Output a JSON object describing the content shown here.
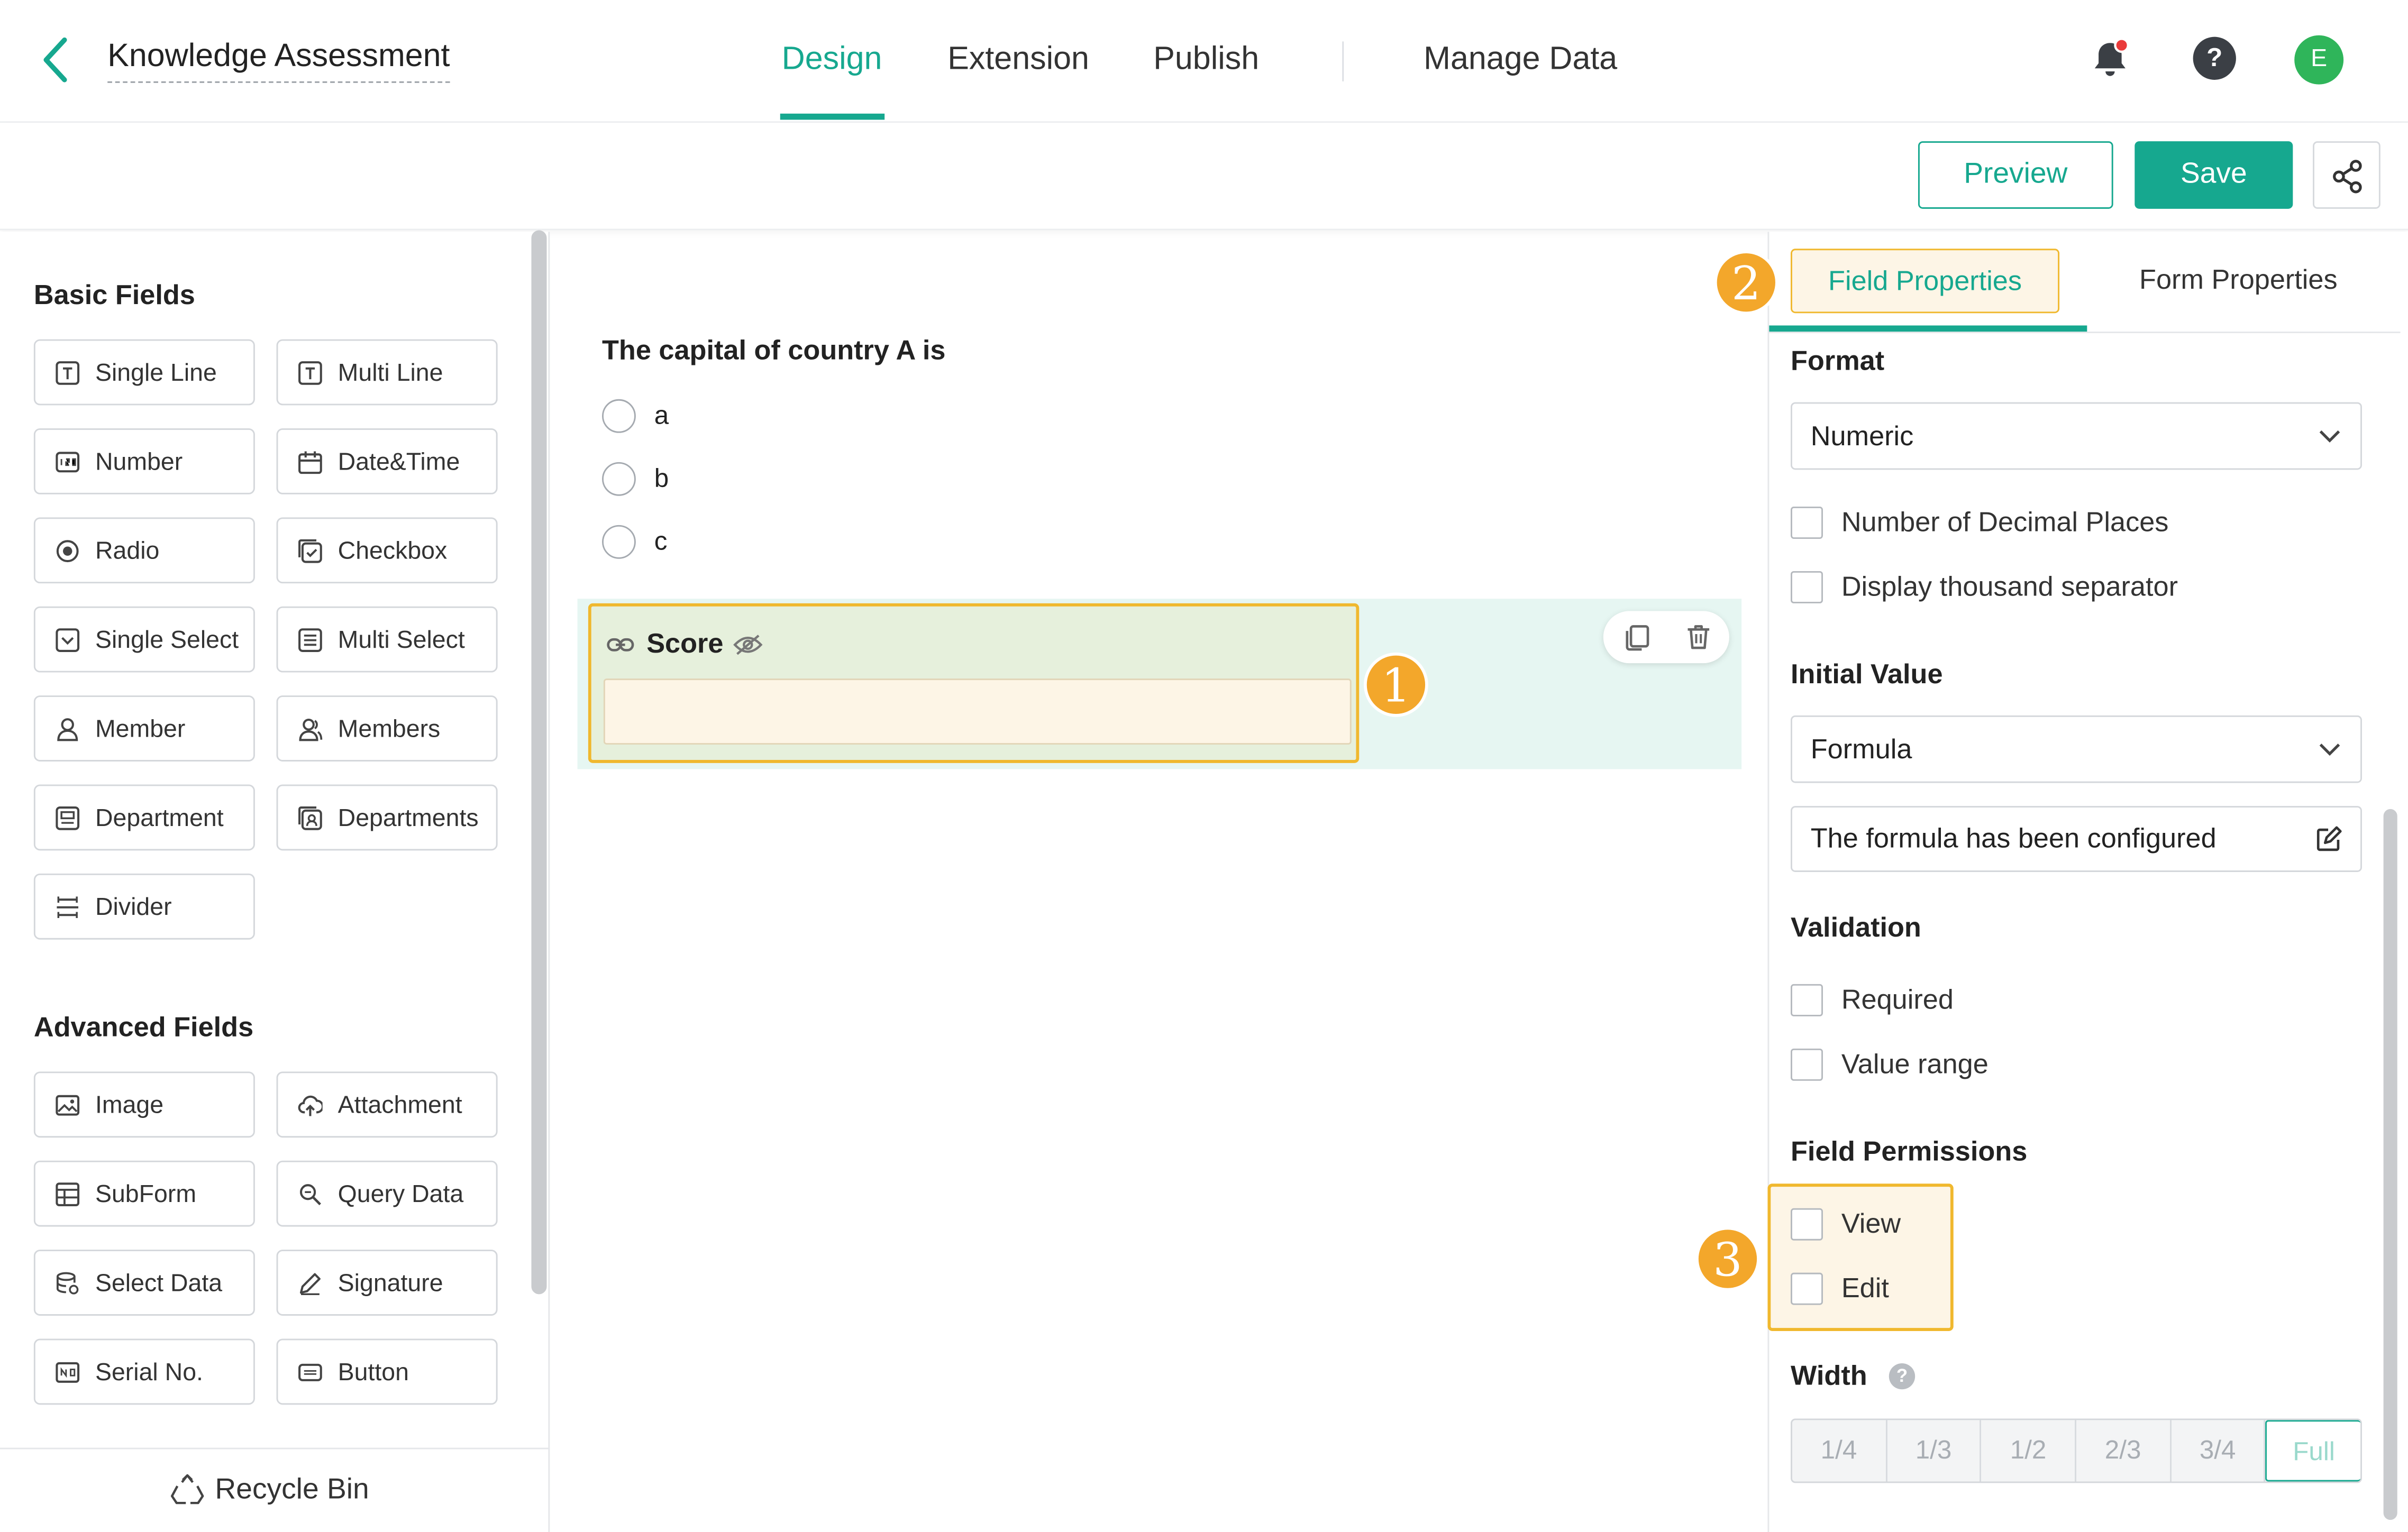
{
  "header": {
    "title": "Knowledge Assessment",
    "tabs": [
      {
        "label": "Design",
        "active": true
      },
      {
        "label": "Extension"
      },
      {
        "label": "Publish"
      },
      {
        "label": "Manage Data"
      }
    ],
    "avatar_initial": "E",
    "help_symbol": "?",
    "accent_color": "#16a88f"
  },
  "toolbar": {
    "preview_label": "Preview",
    "save_label": "Save"
  },
  "left_panel": {
    "basic_heading": "Basic Fields",
    "basic_fields": [
      {
        "label": "Single Line",
        "icon": "single-line-icon"
      },
      {
        "label": "Multi Line",
        "icon": "multi-line-icon"
      },
      {
        "label": "Number",
        "icon": "number-icon"
      },
      {
        "label": "Date&Time",
        "icon": "calendar-icon"
      },
      {
        "label": "Radio",
        "icon": "radio-icon"
      },
      {
        "label": "Checkbox",
        "icon": "checkbox-icon"
      },
      {
        "label": "Single Select",
        "icon": "single-select-icon"
      },
      {
        "label": "Multi Select",
        "icon": "multi-select-icon"
      },
      {
        "label": "Member",
        "icon": "member-icon"
      },
      {
        "label": "Members",
        "icon": "members-icon"
      },
      {
        "label": "Department",
        "icon": "department-icon"
      },
      {
        "label": "Departments",
        "icon": "departments-icon"
      },
      {
        "label": "Divider",
        "icon": "divider-icon"
      }
    ],
    "advanced_heading": "Advanced Fields",
    "advanced_fields": [
      {
        "label": "Image",
        "icon": "image-icon"
      },
      {
        "label": "Attachment",
        "icon": "upload-cloud-icon"
      },
      {
        "label": "SubForm",
        "icon": "subform-icon"
      },
      {
        "label": "Query Data",
        "icon": "query-data-icon"
      },
      {
        "label": "Select Data",
        "icon": "select-data-icon"
      },
      {
        "label": "Signature",
        "icon": "pen-icon"
      },
      {
        "label": "Serial No.",
        "icon": "serial-no-icon"
      },
      {
        "label": "Button",
        "icon": "button-icon"
      }
    ],
    "recycle_label": "Recycle Bin"
  },
  "canvas": {
    "question_title": "The capital of country A is",
    "options": [
      "a",
      "b",
      "c"
    ],
    "selected_field": {
      "label": "Score",
      "value": ""
    },
    "highlight_color": "#f0b82e"
  },
  "callouts": [
    "1",
    "2",
    "3"
  ],
  "right_panel": {
    "tabs": [
      {
        "label": "Field Properties",
        "active": true
      },
      {
        "label": "Form Properties"
      }
    ],
    "format_heading": "Format",
    "format_value": "Numeric",
    "format_options": [
      {
        "label": "Number of Decimal Places",
        "checked": false
      },
      {
        "label": "Display thousand separator",
        "checked": false
      }
    ],
    "initial_value_heading": "Initial Value",
    "initial_value_type": "Formula",
    "formula_status": "The formula has been configured",
    "validation_heading": "Validation",
    "validation_options": [
      {
        "label": "Required",
        "checked": false
      },
      {
        "label": "Value range",
        "checked": false
      }
    ],
    "permissions_heading": "Field Permissions",
    "permission_options": [
      {
        "label": "View",
        "checked": false
      },
      {
        "label": "Edit",
        "checked": false
      }
    ],
    "width_heading": "Width",
    "width_help": "?",
    "width_options": [
      "1/4",
      "1/3",
      "1/2",
      "2/3",
      "3/4",
      "Full"
    ],
    "width_selected": "Full"
  }
}
